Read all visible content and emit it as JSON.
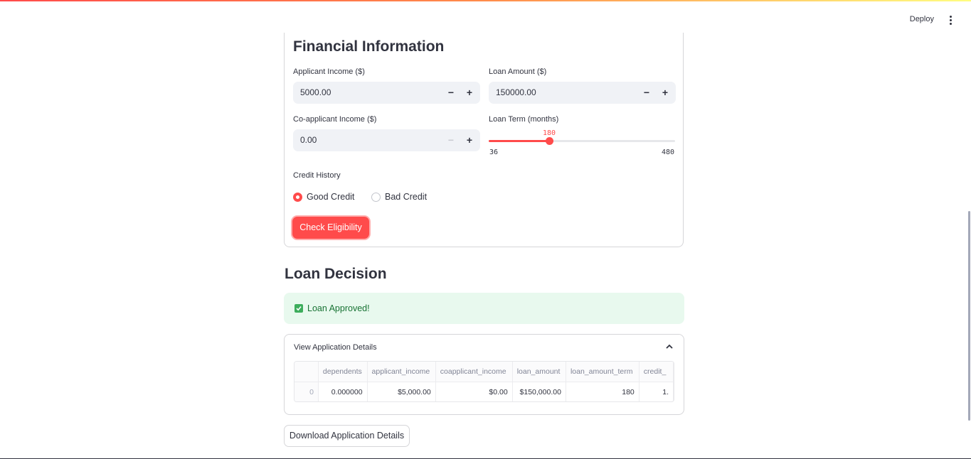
{
  "header": {
    "deploy_label": "Deploy",
    "menu_icon": "kebab-menu-icon"
  },
  "financial": {
    "title": "Financial Information",
    "applicant_income": {
      "label": "Applicant Income ($)",
      "value": "5000.00"
    },
    "loan_amount": {
      "label": "Loan Amount ($)",
      "value": "150000.00"
    },
    "coapplicant_income": {
      "label": "Co-applicant Income ($)",
      "value": "0.00"
    },
    "loan_term": {
      "label": "Loan Term (months)",
      "value": 180,
      "min": 36,
      "max": 480,
      "value_text": "180",
      "min_text": "36",
      "max_text": "480"
    },
    "stepper": {
      "minus": "−",
      "plus": "+"
    },
    "credit_history": {
      "label": "Credit History",
      "options": [
        "Good Credit",
        "Bad Credit"
      ],
      "selected": "Good Credit"
    },
    "submit_label": "Check Eligibility"
  },
  "decision": {
    "title": "Loan Decision",
    "message": "Loan Approved!",
    "details": {
      "title": "View Application Details",
      "columns": [
        "",
        "dependents",
        "applicant_income",
        "coapplicant_income",
        "loan_amount",
        "loan_amount_term",
        "credit_"
      ],
      "rows": [
        [
          "0",
          "0.000000",
          "$5,000.00",
          "$0.00",
          "$150,000.00",
          "180",
          "1."
        ]
      ]
    }
  },
  "download_label": "Download Application Details",
  "colors": {
    "accent": "#ff4b4b",
    "success_bg": "#e8f9ee",
    "success_text": "#177233"
  }
}
